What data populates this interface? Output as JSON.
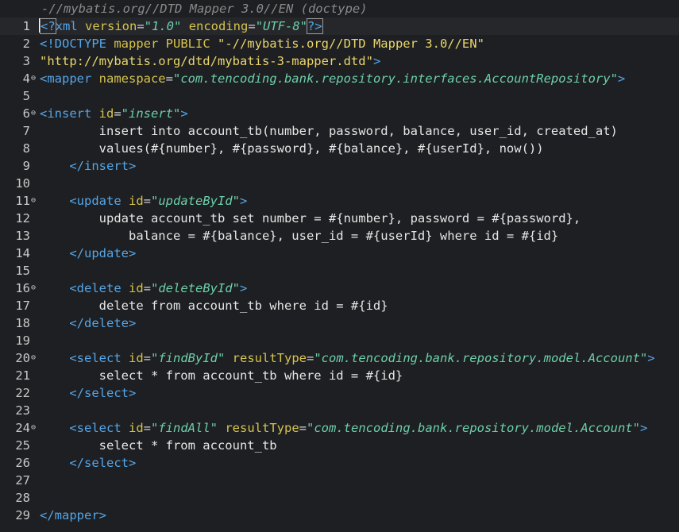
{
  "header": {
    "label": "-//mybatis.org//DTD Mapper 3.0//EN (doctype)"
  },
  "lines": [
    {
      "n": "1",
      "fold": "",
      "current": true,
      "tokens": [
        {
          "t": "<?",
          "c": "tag",
          "b": true
        },
        {
          "t": "xml ",
          "c": "tag"
        },
        {
          "t": "version",
          "c": "attr"
        },
        {
          "t": "=",
          "c": "eq"
        },
        {
          "t": "\"1.0\"",
          "c": "val"
        },
        {
          "t": " "
        },
        {
          "t": "encoding",
          "c": "attr"
        },
        {
          "t": "=",
          "c": "eq"
        },
        {
          "t": "\"UTF-8\"",
          "c": "val"
        },
        {
          "t": "?>",
          "c": "tag",
          "b": true
        }
      ]
    },
    {
      "n": "2",
      "fold": "",
      "tokens": [
        {
          "t": "<!DOCTYPE ",
          "c": "tag"
        },
        {
          "t": "mapper ",
          "c": "attr"
        },
        {
          "t": "PUBLIC ",
          "c": "attr"
        },
        {
          "t": "\"-//mybatis.org//DTD Mapper 3.0//EN\"",
          "c": "str"
        }
      ]
    },
    {
      "n": "3",
      "fold": "",
      "tokens": [
        {
          "t": "\"http://mybatis.org/dtd/mybatis-3-mapper.dtd\"",
          "c": "str"
        },
        {
          "t": ">",
          "c": "tag"
        }
      ]
    },
    {
      "n": "4",
      "fold": "⊖",
      "tokens": [
        {
          "t": "<mapper ",
          "c": "tag"
        },
        {
          "t": "namespace",
          "c": "attr"
        },
        {
          "t": "=",
          "c": "eq"
        },
        {
          "t": "\"com.tencoding.bank.repository.interfaces.AccountRepository\"",
          "c": "val"
        },
        {
          "t": ">",
          "c": "tag"
        }
      ]
    },
    {
      "n": "5",
      "fold": "",
      "tokens": []
    },
    {
      "n": "6",
      "fold": "⊖",
      "tokens": [
        {
          "t": "<insert ",
          "c": "tag"
        },
        {
          "t": "id",
          "c": "attr"
        },
        {
          "t": "=",
          "c": "eq"
        },
        {
          "t": "\"insert\"",
          "c": "val"
        },
        {
          "t": ">",
          "c": "tag"
        }
      ]
    },
    {
      "n": "7",
      "fold": "",
      "tokens": [
        {
          "t": "        insert into account_tb(number, password, balance, user_id, created_at)"
        }
      ]
    },
    {
      "n": "8",
      "fold": "",
      "tokens": [
        {
          "t": "        values(#{number}, #{password}, #{balance}, #{userId}, now())"
        }
      ]
    },
    {
      "n": "9",
      "fold": "",
      "tokens": [
        {
          "t": "    "
        },
        {
          "t": "</insert>",
          "c": "tag"
        }
      ]
    },
    {
      "n": "10",
      "fold": "",
      "tokens": []
    },
    {
      "n": "11",
      "fold": "⊖",
      "tokens": [
        {
          "t": "    "
        },
        {
          "t": "<update ",
          "c": "tag"
        },
        {
          "t": "id",
          "c": "attr"
        },
        {
          "t": "=",
          "c": "eq"
        },
        {
          "t": "\"updateById\"",
          "c": "val"
        },
        {
          "t": ">",
          "c": "tag"
        }
      ]
    },
    {
      "n": "12",
      "fold": "",
      "tokens": [
        {
          "t": "        update account_tb set number = #{number}, password = #{password},"
        }
      ]
    },
    {
      "n": "13",
      "fold": "",
      "tokens": [
        {
          "t": "            balance = #{balance}, user_id = #{userId} where id = #{id}"
        }
      ]
    },
    {
      "n": "14",
      "fold": "",
      "tokens": [
        {
          "t": "    "
        },
        {
          "t": "</update>",
          "c": "tag"
        }
      ]
    },
    {
      "n": "15",
      "fold": "",
      "tokens": []
    },
    {
      "n": "16",
      "fold": "⊖",
      "tokens": [
        {
          "t": "    "
        },
        {
          "t": "<delete ",
          "c": "tag"
        },
        {
          "t": "id",
          "c": "attr"
        },
        {
          "t": "=",
          "c": "eq"
        },
        {
          "t": "\"deleteById\"",
          "c": "val"
        },
        {
          "t": ">",
          "c": "tag"
        }
      ]
    },
    {
      "n": "17",
      "fold": "",
      "tokens": [
        {
          "t": "        delete from account_tb where id = #{id}"
        }
      ]
    },
    {
      "n": "18",
      "fold": "",
      "tokens": [
        {
          "t": "    "
        },
        {
          "t": "</delete>",
          "c": "tag"
        }
      ]
    },
    {
      "n": "19",
      "fold": "",
      "tokens": []
    },
    {
      "n": "20",
      "fold": "⊖",
      "tokens": [
        {
          "t": "    "
        },
        {
          "t": "<select ",
          "c": "tag"
        },
        {
          "t": "id",
          "c": "attr"
        },
        {
          "t": "=",
          "c": "eq"
        },
        {
          "t": "\"findById\"",
          "c": "val"
        },
        {
          "t": " "
        },
        {
          "t": "resultType",
          "c": "attr"
        },
        {
          "t": "=",
          "c": "eq"
        },
        {
          "t": "\"com.tencoding.bank.repository.model.Account\"",
          "c": "val"
        },
        {
          "t": ">",
          "c": "tag"
        }
      ]
    },
    {
      "n": "21",
      "fold": "",
      "tokens": [
        {
          "t": "        select * from account_tb where id = #{id}"
        }
      ]
    },
    {
      "n": "22",
      "fold": "",
      "tokens": [
        {
          "t": "    "
        },
        {
          "t": "</select>",
          "c": "tag"
        }
      ]
    },
    {
      "n": "23",
      "fold": "",
      "tokens": []
    },
    {
      "n": "24",
      "fold": "⊖",
      "tokens": [
        {
          "t": "    "
        },
        {
          "t": "<select ",
          "c": "tag"
        },
        {
          "t": "id",
          "c": "attr"
        },
        {
          "t": "=",
          "c": "eq"
        },
        {
          "t": "\"findAll\"",
          "c": "val"
        },
        {
          "t": " "
        },
        {
          "t": "resultType",
          "c": "attr"
        },
        {
          "t": "=",
          "c": "eq"
        },
        {
          "t": "\"com.tencoding.bank.repository.model.Account\"",
          "c": "val"
        },
        {
          "t": ">",
          "c": "tag"
        }
      ]
    },
    {
      "n": "25",
      "fold": "",
      "tokens": [
        {
          "t": "        select * from account_tb"
        }
      ]
    },
    {
      "n": "26",
      "fold": "",
      "tokens": [
        {
          "t": "    "
        },
        {
          "t": "</select>",
          "c": "tag"
        }
      ]
    },
    {
      "n": "27",
      "fold": "",
      "tokens": []
    },
    {
      "n": "28",
      "fold": "",
      "tokens": []
    },
    {
      "n": "29",
      "fold": "",
      "tokens": [
        {
          "t": "</mapper>",
          "c": "tag"
        }
      ]
    }
  ]
}
